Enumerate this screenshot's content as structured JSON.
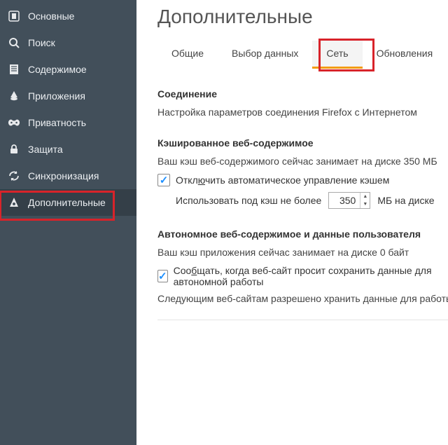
{
  "sidebar": [
    {
      "name": "main",
      "label": "Основные"
    },
    {
      "name": "search",
      "label": "Поиск"
    },
    {
      "name": "content",
      "label": "Содержимое"
    },
    {
      "name": "apps",
      "label": "Приложения"
    },
    {
      "name": "privacy",
      "label": "Приватность"
    },
    {
      "name": "security",
      "label": "Защита"
    },
    {
      "name": "sync",
      "label": "Синхронизация"
    },
    {
      "name": "advanced",
      "label": "Дополнительные",
      "active": true
    }
  ],
  "page_title": "Дополнительные",
  "tabs": [
    {
      "name": "general",
      "label": "Общие"
    },
    {
      "name": "datachoice",
      "label": "Выбор данных"
    },
    {
      "name": "network",
      "label": "Сеть",
      "selected": true
    },
    {
      "name": "updates",
      "label": "Обновления"
    }
  ],
  "connection": {
    "title": "Соединение",
    "desc": "Настройка параметров соединения Firefox с Интернетом"
  },
  "cached": {
    "title": "Кэшированное веб-содержимое",
    "usage": "Ваш кэш веб-содержимого сейчас занимает на диске 350 МБ",
    "override_pre": "Откл",
    "override_u": "ю",
    "override_post": "чить автоматическое управление кэшем",
    "limit_label": "Использовать под кэш не более",
    "limit_value": "350",
    "limit_unit": "МБ на диске"
  },
  "offline": {
    "title": "Автономное веб-содержимое и данные пользователя",
    "usage": "Ваш кэш приложения сейчас занимает на диске 0 байт",
    "tell_pre": "Соо",
    "tell_u": "б",
    "tell_post": "щать, когда веб-сайт просит сохранить данные для автономной работы",
    "allowed": "Следующим веб-сайтам разрешено хранить данные для работы в автономном режиме:"
  }
}
